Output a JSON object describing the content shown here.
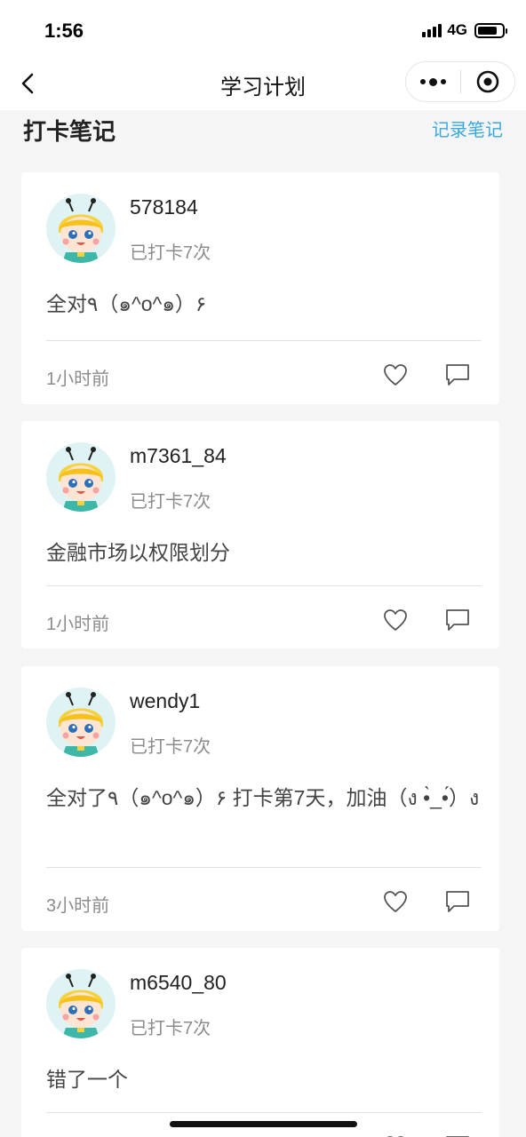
{
  "status_bar": {
    "time": "1:56",
    "network": "4G"
  },
  "nav": {
    "title": "学习计划"
  },
  "section": {
    "title": "打卡笔记",
    "action_label": "记录笔记"
  },
  "posts": [
    {
      "username": "578184",
      "checkin": "已打卡7次",
      "content": "全对٩（๑^o^๑）۶",
      "time": "1小时前"
    },
    {
      "username": "m7361_84",
      "checkin": "已打卡7次",
      "content": "金融市场以权限划分",
      "time": "1小时前"
    },
    {
      "username": "wendy1",
      "checkin": "已打卡7次",
      "content": "全对了٩（๑^o^๑）۶ 打卡第7天，加油（ง •̀_•́）ง",
      "time": "3小时前"
    },
    {
      "username": "m6540_80",
      "checkin": "已打卡7次",
      "content": "错了一个",
      "time": ""
    }
  ],
  "colors": {
    "accent": "#3aa8df",
    "background": "#f5f5f5"
  },
  "icons": {
    "like": "heart-icon",
    "comment": "comment-icon",
    "back": "chevron-left-icon",
    "more": "more-icon",
    "close": "target-icon"
  }
}
